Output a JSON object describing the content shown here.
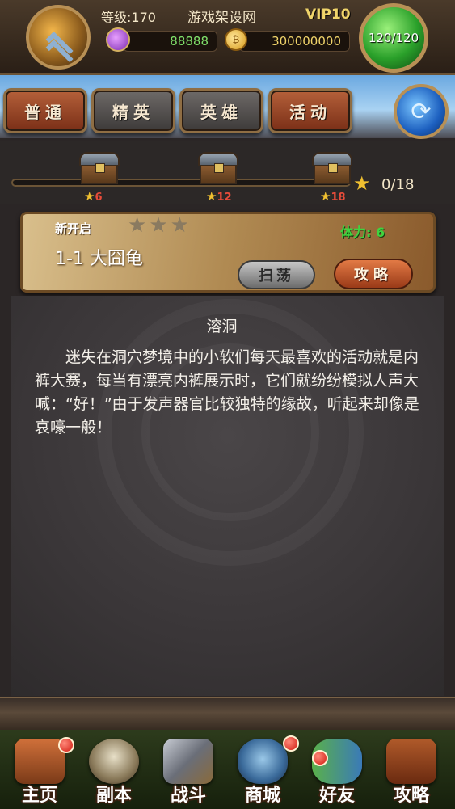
{
  "header": {
    "level": "等级:170",
    "site_name": "游戏架设网",
    "vip": "VIP10",
    "gems": "88888",
    "gold": "300000000",
    "energy": "120/120"
  },
  "tabs": [
    {
      "label": "普通",
      "active": true
    },
    {
      "label": "精英",
      "active": false
    },
    {
      "label": "英雄",
      "active": false
    },
    {
      "label": "活动",
      "active": false
    }
  ],
  "chests": [
    {
      "stars_required": "6"
    },
    {
      "stars_required": "12"
    },
    {
      "stars_required": "18"
    }
  ],
  "star_progress": "0/18",
  "stage": {
    "status": "新开启",
    "stars_earned": 0,
    "stars_max": 3,
    "stamina": "体力: 6",
    "name": "1-1 大囧龟",
    "sweep_label": "扫荡",
    "guide_label": "攻略"
  },
  "description": {
    "title": "溶洞",
    "body": "迷失在洞穴梦境中的小软们每天最喜欢的活动就是内裤大赛，每当有漂亮内裤展示时，它们就纷纷模拟人声大喊：“好！”由于发声器官比较独特的缘故，听起来却像是哀嚎一般！"
  },
  "nav": [
    {
      "label": "主页",
      "icon": "house-icon",
      "badge": true
    },
    {
      "label": "副本",
      "icon": "skull-icon",
      "badge": false
    },
    {
      "label": "战斗",
      "icon": "swords-icon",
      "badge": false
    },
    {
      "label": "商城",
      "icon": "monster-shop-icon",
      "badge": true
    },
    {
      "label": "好友",
      "icon": "friends-icon",
      "badge": true
    },
    {
      "label": "攻略",
      "icon": "book-icon",
      "badge": false
    }
  ],
  "colors": {
    "active_tab": "#b5613a",
    "inactive_tab": "#6e6a68",
    "stamina_text": "#3fd43f",
    "chest_requirement": "#e84c3a",
    "star": "#f0c030"
  }
}
